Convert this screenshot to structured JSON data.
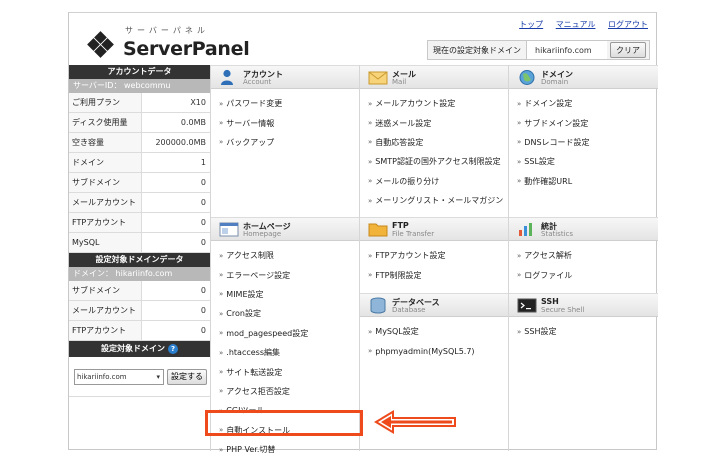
{
  "logo": {
    "sub": "サーバーパネル",
    "main": "ServerPanel"
  },
  "toplinks": [
    "トップ",
    "マニュアル",
    "ログアウト"
  ],
  "current_domain": {
    "label": "現在の設定対象ドメイン",
    "value": "hikariinfo.com",
    "clear_label": "クリア"
  },
  "account_data": {
    "title": "アカウントデータ",
    "server_id": "サーバーID： webcommu",
    "rows": [
      {
        "key": "ご利用プラン",
        "value": "X10"
      },
      {
        "key": "ディスク使用量",
        "value": "0.0MB"
      },
      {
        "key": "空き容量",
        "value": "200000.0MB"
      },
      {
        "key": "ドメイン",
        "value": "1"
      },
      {
        "key": "サブドメイン",
        "value": "0"
      },
      {
        "key": "メールアカウント",
        "value": "0"
      },
      {
        "key": "FTPアカウント",
        "value": "0"
      },
      {
        "key": "MySQL",
        "value": "0"
      }
    ]
  },
  "domain_data": {
    "title": "設定対象ドメインデータ",
    "domain": "ドメイン： hikariinfo.com",
    "rows": [
      {
        "key": "サブドメイン",
        "value": "0"
      },
      {
        "key": "メールアカウント",
        "value": "0"
      },
      {
        "key": "FTPアカウント",
        "value": "0"
      }
    ]
  },
  "domain_select": {
    "title": "設定対象ドメイン",
    "help": "?",
    "selected": "hikariinfo.com",
    "button": "設定する"
  },
  "sections": {
    "account": {
      "title": "アカウント",
      "sub": "Account",
      "items": [
        "パスワード変更",
        "サーバー情報",
        "バックアップ"
      ]
    },
    "mail": {
      "title": "メール",
      "sub": "Mail",
      "items": [
        "メールアカウント設定",
        "迷惑メール設定",
        "自動応答設定",
        "SMTP認証の国外アクセス制限設定",
        "メールの振り分け",
        "メーリングリスト・メールマガジン"
      ]
    },
    "domain": {
      "title": "ドメイン",
      "sub": "Domain",
      "items": [
        "ドメイン設定",
        "サブドメイン設定",
        "DNSレコード設定",
        "SSL設定",
        "動作確認URL"
      ]
    },
    "homepage": {
      "title": "ホームページ",
      "sub": "Homepage",
      "items": [
        "アクセス制限",
        "エラーページ設定",
        "MIME設定",
        "Cron設定",
        "mod_pagespeed設定",
        ".htaccess編集",
        "サイト転送設定",
        "アクセス拒否設定",
        "CGIツール",
        "自動インストール",
        "PHP Ver.切替"
      ]
    },
    "ftp": {
      "title": "FTP",
      "sub": "File Transfer",
      "items": [
        "FTPアカウント設定",
        "FTP制限設定"
      ]
    },
    "stats": {
      "title": "統計",
      "sub": "Statistics",
      "items": [
        "アクセス解析",
        "ログファイル"
      ]
    },
    "database": {
      "title": "データベース",
      "sub": "Database",
      "items": [
        "MySQL設定",
        "phpmyadmin(MySQL5.7)"
      ]
    },
    "ssh": {
      "title": "SSH",
      "sub": "Secure Shell",
      "items": [
        "SSH設定"
      ]
    }
  },
  "colors": {
    "highlight": "#ee4a1c",
    "link": "#1a3ea8",
    "header": "#333333"
  }
}
